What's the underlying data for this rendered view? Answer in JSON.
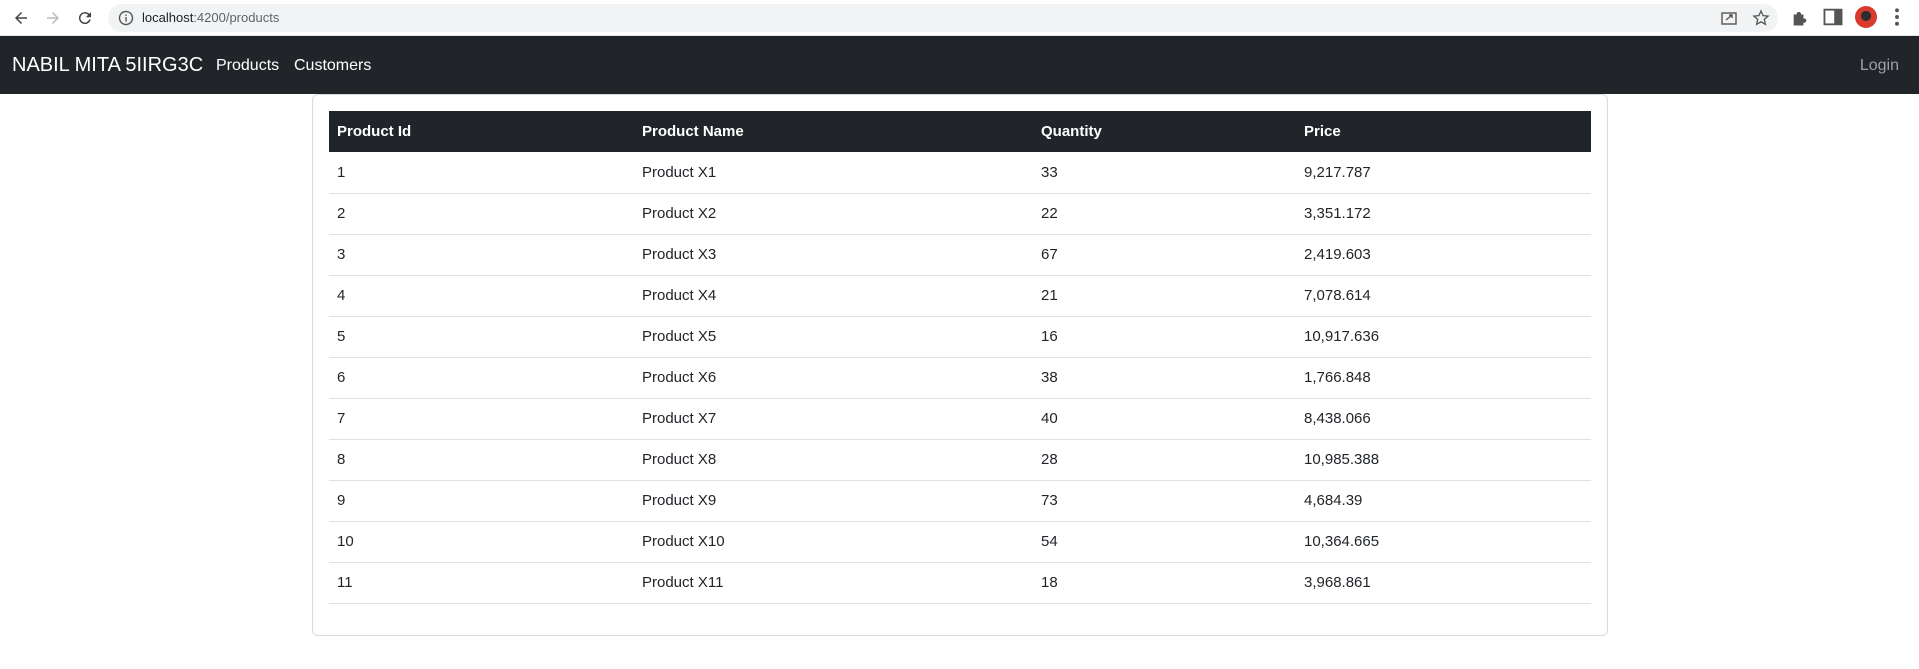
{
  "browser": {
    "url_host": "localhost",
    "url_path": ":4200/products"
  },
  "navbar": {
    "brand": "NABIL MITA 5IIRG3C",
    "links": [
      "Products",
      "Customers"
    ],
    "login": "Login"
  },
  "table": {
    "headers": [
      "Product Id",
      "Product Name",
      "Quantity",
      "Price"
    ],
    "rows": [
      [
        "1",
        "Product X1",
        "33",
        "9,217.787"
      ],
      [
        "2",
        "Product X2",
        "22",
        "3,351.172"
      ],
      [
        "3",
        "Product X3",
        "67",
        "2,419.603"
      ],
      [
        "4",
        "Product X4",
        "21",
        "7,078.614"
      ],
      [
        "5",
        "Product X5",
        "16",
        "10,917.636"
      ],
      [
        "6",
        "Product X6",
        "38",
        "1,766.848"
      ],
      [
        "7",
        "Product X7",
        "40",
        "8,438.066"
      ],
      [
        "8",
        "Product X8",
        "28",
        "10,985.388"
      ],
      [
        "9",
        "Product X9",
        "73",
        "4,684.39"
      ],
      [
        "10",
        "Product X10",
        "54",
        "10,364.665"
      ],
      [
        "11",
        "Product X11",
        "18",
        "3,968.861"
      ]
    ]
  }
}
